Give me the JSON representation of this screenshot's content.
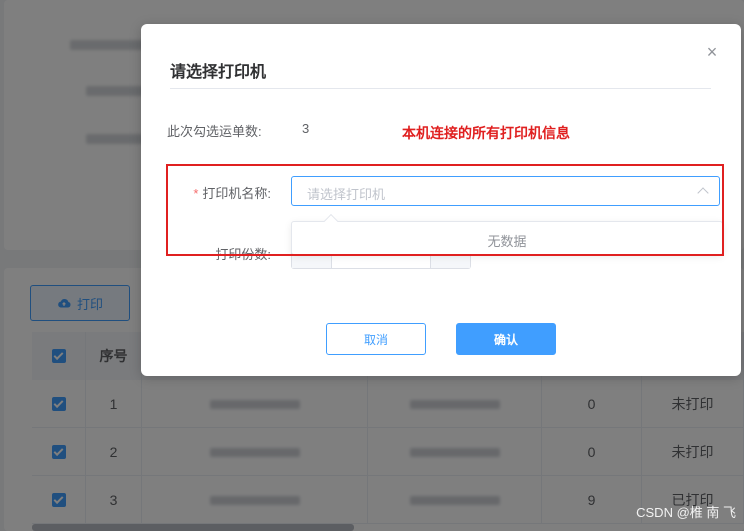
{
  "dialog": {
    "title": "请选择打印机",
    "close_glyph": "×",
    "count_label": "此次勾选运单数:",
    "count_value": "3",
    "annotation": "本机连接的所有打印机信息",
    "printer_label": "打印机名称:",
    "required_mark": "*",
    "printer_placeholder": "请选择打印机",
    "dropdown_empty": "无数据",
    "copies_label": "打印份数:",
    "cancel_label": "取消",
    "confirm_label": "确认"
  },
  "page": {
    "print_button_label": "打印",
    "table": {
      "headers": [
        "序号"
      ],
      "rows": [
        {
          "index": "1",
          "qty": "0",
          "status": "未打印"
        },
        {
          "index": "2",
          "qty": "0",
          "status": "未打印"
        },
        {
          "index": "3",
          "qty": "9",
          "status": "已打印"
        }
      ]
    }
  },
  "watermark": "CSDN @椎 南 飞",
  "colors": {
    "primary": "#409eff",
    "annotation": "#e02020",
    "required": "#f56c6c"
  },
  "icons": {
    "upload": "cloud-upload-icon",
    "close": "close-icon",
    "select_arrow": "chevron-up-icon",
    "checkbox": "checkbox-checked-icon"
  }
}
